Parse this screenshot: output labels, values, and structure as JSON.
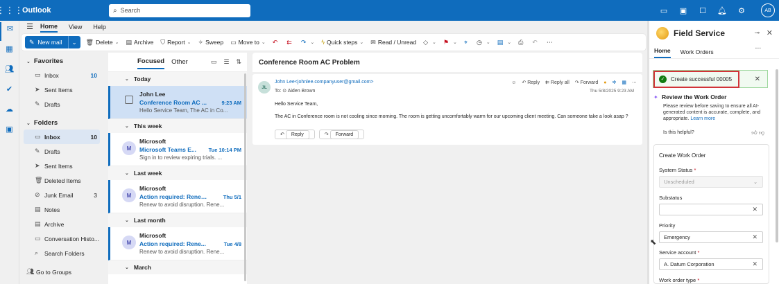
{
  "topbar": {
    "app": "Outlook",
    "search_placeholder": "Search",
    "avatar": "AB"
  },
  "ribbon": {
    "tabs": [
      "Home",
      "View",
      "Help"
    ],
    "new_mail": "New mail",
    "delete": "Delete",
    "archive": "Archive",
    "report": "Report",
    "sweep": "Sweep",
    "move_to": "Move to",
    "quick_steps": "Quick steps",
    "read_unread": "Read / Unread"
  },
  "folders": {
    "favorites_label": "Favorites",
    "favorites": [
      {
        "label": "Inbox",
        "count": "10"
      },
      {
        "label": "Sent Items",
        "count": ""
      },
      {
        "label": "Drafts",
        "count": ""
      }
    ],
    "folders_label": "Folders",
    "items": [
      {
        "label": "Inbox",
        "count": "10"
      },
      {
        "label": "Drafts",
        "count": ""
      },
      {
        "label": "Sent Items",
        "count": ""
      },
      {
        "label": "Deleted Items",
        "count": ""
      },
      {
        "label": "Junk Email",
        "count": "3"
      },
      {
        "label": "Notes",
        "count": ""
      },
      {
        "label": "Archive",
        "count": ""
      },
      {
        "label": "Conversation Histo...",
        "count": ""
      },
      {
        "label": "Search Folders",
        "count": ""
      }
    ],
    "go_to_groups": "Go to Groups"
  },
  "message_list": {
    "tab_focused": "Focused",
    "tab_other": "Other",
    "groups": [
      "Today",
      "This week",
      "Last week",
      "Last month",
      "March"
    ],
    "messages": [
      {
        "from": "John Lee",
        "subject": "Conference Room AC ...",
        "time": "9:23 AM",
        "preview": "Hello Service Team, The AC in Co..."
      },
      {
        "avatar": "M",
        "from": "Microsoft",
        "subject": "Microsoft Teams E...",
        "time": "Tue 10:14 PM",
        "preview": "Sign in to review expiring trials. ..."
      },
      {
        "avatar": "M",
        "from": "Microsoft",
        "subject": "Action required: Renew...",
        "time": "Thu 5/1",
        "preview": "Renew to avoid disruption. Rene..."
      },
      {
        "avatar": "M",
        "from": "Microsoft",
        "subject": "Action required: Rene...",
        "time": "Tue 4/8",
        "preview": "Renew to avoid disruption. Rene..."
      }
    ]
  },
  "reading": {
    "title": "Conference Room AC Problem",
    "avatar": "JL",
    "from": "John Lee<johnlee.companyuser@gmail.com>",
    "to": "To: ⊙ Aiden Brown",
    "reply": "Reply",
    "reply_all": "Reply all",
    "forward": "Forward",
    "date": "Thu 5/8/2025 9:23 AM",
    "greeting": "Hello Service Team,",
    "body": "The AC in Conference room is not cooling since morning. The room is getting uncomfortably warm for our upcoming client meeting. Can someone take a look asap ?"
  },
  "field_service": {
    "title": "Field Service",
    "tabs": [
      "Home",
      "Work Orders"
    ],
    "toast": "Create successful 00005",
    "review_title": "Review the Work Order",
    "review_desc": "Please review before saving to ensure all AI-generated content is accurate, complete, and appropriate.",
    "learn_more": "Learn more",
    "helpful": "Is this helpful?",
    "form_title": "Create Work Order",
    "fields": [
      {
        "label": "System Status",
        "required": true,
        "value": "Unscheduled"
      },
      {
        "label": "Substatus",
        "required": false,
        "value": ""
      },
      {
        "label": "Priority",
        "required": false,
        "value": "Emergency"
      },
      {
        "label": "Service account",
        "required": true,
        "value": "A. Datum Corporation"
      },
      {
        "label": "Work order type",
        "required": true,
        "value": ""
      }
    ]
  }
}
